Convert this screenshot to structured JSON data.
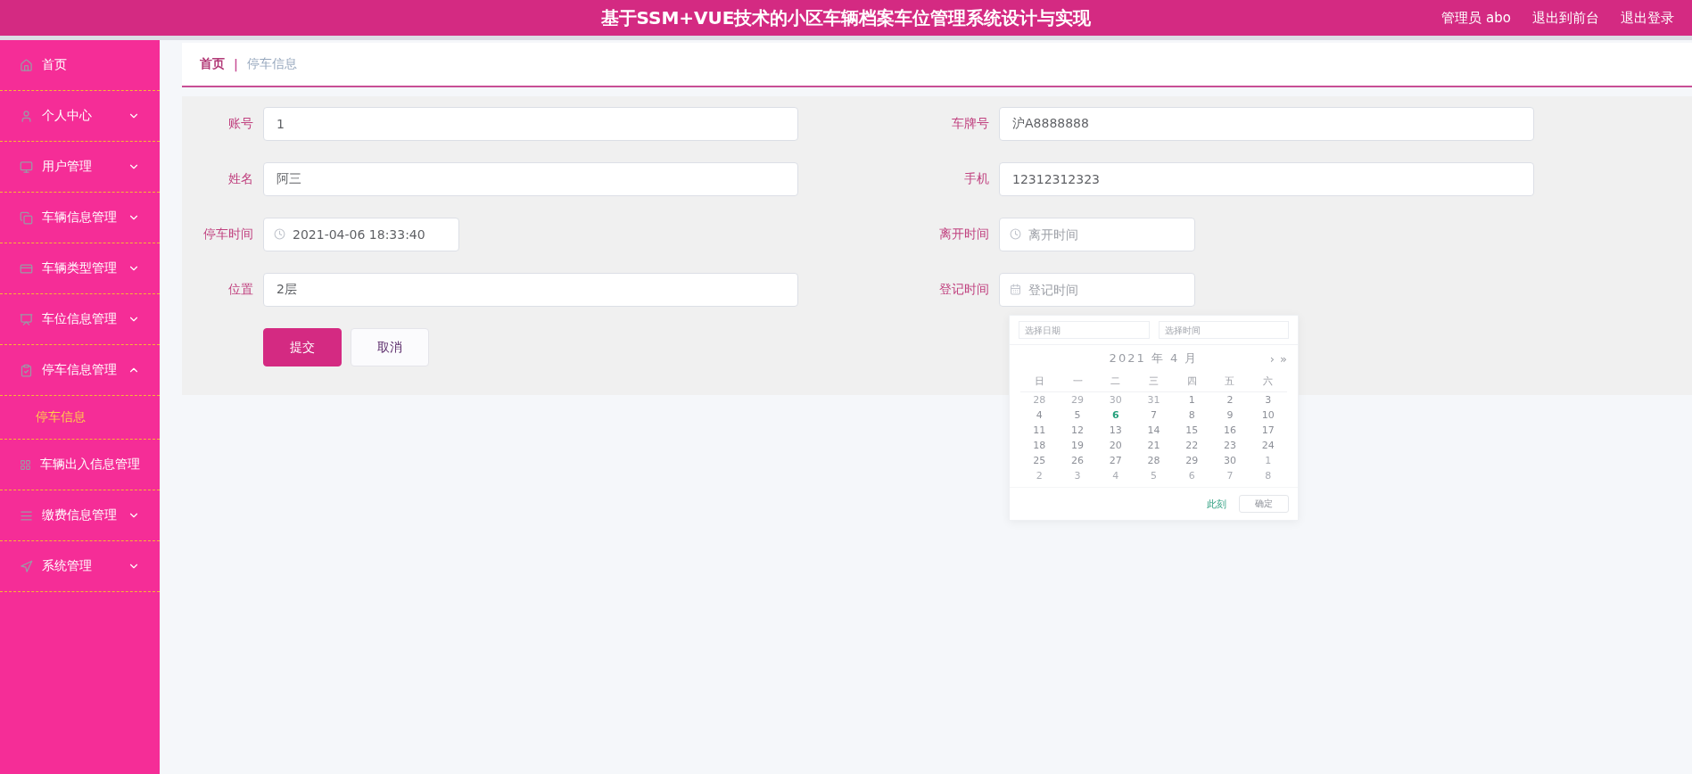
{
  "header": {
    "title": "基于SSM+VUE技术的小区车辆档案车位管理系统设计与实现",
    "links": [
      "管理员 abo",
      "退出到前台",
      "退出登录"
    ]
  },
  "sidebar": {
    "items": [
      {
        "label": "首页",
        "kind": "link"
      },
      {
        "label": "个人中心",
        "kind": "menu",
        "expanded": false
      },
      {
        "label": "用户管理",
        "kind": "menu",
        "expanded": false
      },
      {
        "label": "车辆信息管理",
        "kind": "menu",
        "expanded": false
      },
      {
        "label": "车辆类型管理",
        "kind": "menu",
        "expanded": false
      },
      {
        "label": "车位信息管理",
        "kind": "menu",
        "expanded": false
      },
      {
        "label": "停车信息管理",
        "kind": "menu",
        "expanded": true,
        "children": [
          {
            "label": "停车信息",
            "selected": true
          }
        ]
      },
      {
        "label": "车辆出入信息管理",
        "kind": "link"
      },
      {
        "label": "缴费信息管理",
        "kind": "menu",
        "expanded": false
      },
      {
        "label": "系统管理",
        "kind": "menu",
        "expanded": false
      }
    ]
  },
  "breadcrumb": {
    "items": [
      "首页",
      "停车信息"
    ],
    "separator": "|"
  },
  "form": {
    "fields": [
      {
        "label": "账号",
        "kind": "text",
        "value": "1"
      },
      {
        "label": "车牌号",
        "kind": "text",
        "value": "沪A8888888"
      },
      {
        "label": "姓名",
        "kind": "text",
        "value": "阿三"
      },
      {
        "label": "手机",
        "kind": "text",
        "value": "12312312323"
      },
      {
        "label": "停车时间",
        "kind": "time",
        "value": "2021-04-06 18:33:40"
      },
      {
        "label": "离开时间",
        "kind": "time",
        "placeholder": "离开时间"
      },
      {
        "label": "位置",
        "kind": "text",
        "value": "2层"
      },
      {
        "label": "登记时间",
        "kind": "date",
        "placeholder": "登记时间"
      }
    ],
    "buttons": [
      {
        "label": "提交",
        "kind": "primary"
      },
      {
        "label": "取消",
        "kind": "plain"
      }
    ]
  },
  "date_picker": {
    "placeholders": [
      "选择日期",
      "选择时间"
    ],
    "month": "2021 年 4 月",
    "nav": [
      "›",
      "»"
    ],
    "weekdays": [
      "日",
      "一",
      "二",
      "三",
      "四",
      "五",
      "六"
    ],
    "days": [
      {
        "label": "28",
        "kind": "other",
        "selected": false
      },
      {
        "label": "29",
        "kind": "other",
        "selected": false
      },
      {
        "label": "30",
        "kind": "other",
        "selected": false
      },
      {
        "label": "31",
        "kind": "other",
        "selected": false
      },
      {
        "label": "1",
        "kind": "current",
        "selected": false
      },
      {
        "label": "2",
        "kind": "current",
        "selected": false
      },
      {
        "label": "3",
        "kind": "current",
        "selected": false
      },
      {
        "label": "4",
        "kind": "current",
        "selected": false
      },
      {
        "label": "5",
        "kind": "current",
        "selected": false
      },
      {
        "label": "6",
        "kind": "current",
        "selected": true
      },
      {
        "label": "7",
        "kind": "current",
        "selected": false
      },
      {
        "label": "8",
        "kind": "current",
        "selected": false
      },
      {
        "label": "9",
        "kind": "current",
        "selected": false
      },
      {
        "label": "10",
        "kind": "current",
        "selected": false
      },
      {
        "label": "11",
        "kind": "current",
        "selected": false
      },
      {
        "label": "12",
        "kind": "current",
        "selected": false
      },
      {
        "label": "13",
        "kind": "current",
        "selected": false
      },
      {
        "label": "14",
        "kind": "current",
        "selected": false
      },
      {
        "label": "15",
        "kind": "current",
        "selected": false
      },
      {
        "label": "16",
        "kind": "current",
        "selected": false
      },
      {
        "label": "17",
        "kind": "current",
        "selected": false
      },
      {
        "label": "18",
        "kind": "current",
        "selected": false
      },
      {
        "label": "19",
        "kind": "current",
        "selected": false
      },
      {
        "label": "20",
        "kind": "current",
        "selected": false
      },
      {
        "label": "21",
        "kind": "current",
        "selected": false
      },
      {
        "label": "22",
        "kind": "current",
        "selected": false
      },
      {
        "label": "23",
        "kind": "current",
        "selected": false
      },
      {
        "label": "24",
        "kind": "current",
        "selected": false
      },
      {
        "label": "25",
        "kind": "current",
        "selected": false
      },
      {
        "label": "26",
        "kind": "current",
        "selected": false
      },
      {
        "label": "27",
        "kind": "current",
        "selected": false
      },
      {
        "label": "28",
        "kind": "current",
        "selected": false
      },
      {
        "label": "29",
        "kind": "current",
        "selected": false
      },
      {
        "label": "30",
        "kind": "current",
        "selected": false
      },
      {
        "label": "1",
        "kind": "other",
        "selected": false
      },
      {
        "label": "2",
        "kind": "other",
        "selected": false
      },
      {
        "label": "3",
        "kind": "other",
        "selected": false
      },
      {
        "label": "4",
        "kind": "other",
        "selected": false
      },
      {
        "label": "5",
        "kind": "other",
        "selected": false
      },
      {
        "label": "6",
        "kind": "other",
        "selected": false
      },
      {
        "label": "7",
        "kind": "other",
        "selected": false
      },
      {
        "label": "8",
        "kind": "other",
        "selected": false
      }
    ],
    "now": "此刻",
    "ok": "确定"
  }
}
